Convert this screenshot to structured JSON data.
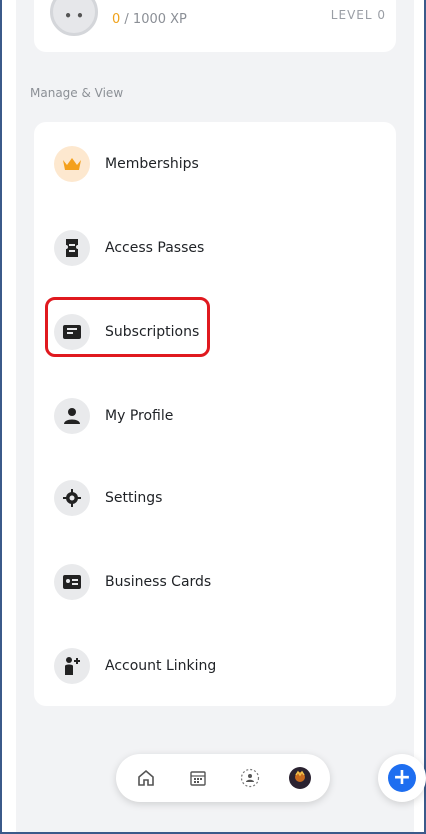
{
  "profile_card": {
    "xp_current": "0",
    "xp_total": " / 1000 XP",
    "level_label": "LEVEL 0"
  },
  "section": {
    "label": "Manage & View"
  },
  "menu": {
    "items": [
      {
        "label": "Memberships",
        "icon": "crown-icon"
      },
      {
        "label": "Access Passes",
        "icon": "ticket-icon"
      },
      {
        "label": "Subscriptions",
        "icon": "inbox-icon"
      },
      {
        "label": "My Profile",
        "icon": "person-icon"
      },
      {
        "label": "Settings",
        "icon": "gear-icon"
      },
      {
        "label": "Business Cards",
        "icon": "id-card-icon"
      },
      {
        "label": "Account Linking",
        "icon": "person-add-icon"
      }
    ]
  },
  "bottom_nav": {
    "items": [
      "home-icon",
      "calendar-icon",
      "community-icon",
      "profile-avatar-icon"
    ]
  },
  "fab": {
    "symbol": "+",
    "icon": "add-icon"
  },
  "colors": {
    "accent": "#1e6ef0",
    "highlight": "#e0191f",
    "crown": "#f4a01c",
    "xp": "#f0a21a"
  }
}
